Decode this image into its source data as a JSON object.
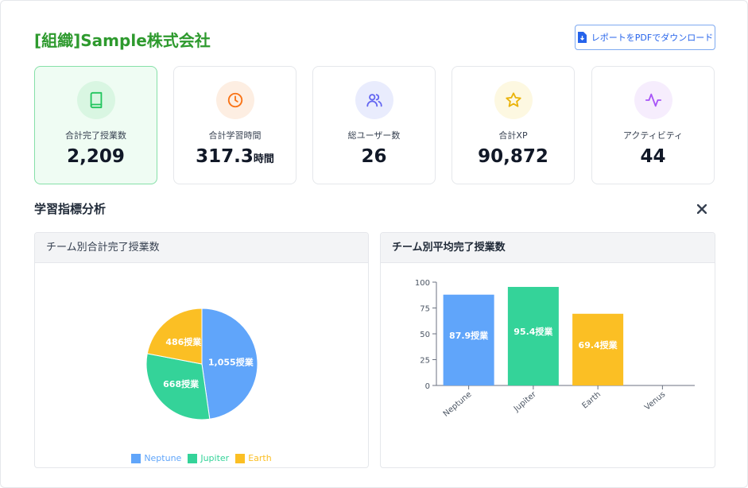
{
  "header": {
    "org_title": "[組織]Sample株式会社",
    "download_label": "レポートをPDFでダウンロード"
  },
  "stats": [
    {
      "label": "合計完了授業数",
      "value": "2,209",
      "unit": "",
      "icon": "book-icon",
      "color": "#22c55e",
      "bg": "#d9f6e2"
    },
    {
      "label": "合計学習時間",
      "value": "317.3",
      "unit": "時間",
      "icon": "clock-icon",
      "color": "#f97316",
      "bg": "#fdeee2"
    },
    {
      "label": "総ユーザー数",
      "value": "26",
      "unit": "",
      "icon": "users-icon",
      "color": "#6366f1",
      "bg": "#e9ecfd"
    },
    {
      "label": "合計XP",
      "value": "90,872",
      "unit": "",
      "icon": "star-icon",
      "color": "#eab308",
      "bg": "#fdf8e1"
    },
    {
      "label": "アクティビティ",
      "value": "44",
      "unit": "",
      "icon": "activity-icon",
      "color": "#a855f7",
      "bg": "#f6edfd"
    }
  ],
  "section": {
    "title": "学習指標分析"
  },
  "chart_data": [
    {
      "type": "pie",
      "title": "チーム別合計完了授業数",
      "categories": [
        "Neptune",
        "Jupiter",
        "Earth"
      ],
      "values": [
        1055,
        668,
        486
      ],
      "labels": [
        "1,055授業",
        "668授業",
        "486授業"
      ],
      "colors": [
        "#60a5fa",
        "#34d399",
        "#fbbf24"
      ],
      "legend": "bottom"
    },
    {
      "type": "bar",
      "title": "チーム別平均完了授業数",
      "categories": [
        "Neptune",
        "Jupiter",
        "Earth",
        "Venus"
      ],
      "values": [
        87.9,
        95.4,
        69.4,
        0
      ],
      "labels": [
        "87.9授業",
        "95.4授業",
        "69.4授業",
        ""
      ],
      "colors": [
        "#60a5fa",
        "#34d399",
        "#fbbf24",
        "#f87171"
      ],
      "yticks": [
        0,
        25,
        50,
        75,
        100
      ],
      "ylim": [
        0,
        100
      ]
    }
  ]
}
